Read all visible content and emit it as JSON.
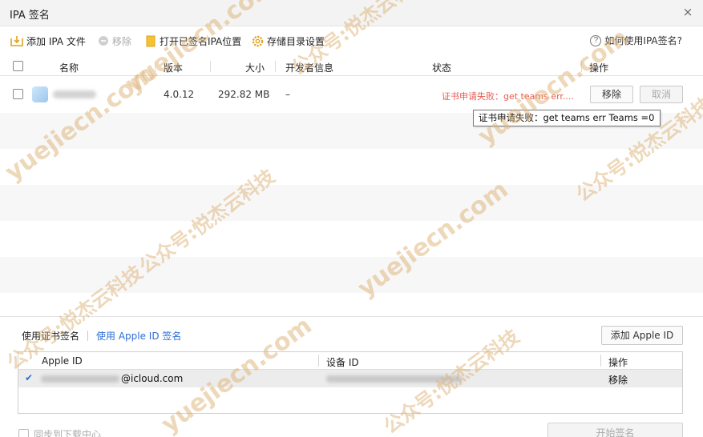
{
  "window": {
    "title": "IPA 签名",
    "close_glyph": "×"
  },
  "toolbar": {
    "add_ipa": "添加 IPA 文件",
    "remove": "移除",
    "open_signed": "打开已签名IPA位置",
    "storage_settings": "存储目录设置",
    "help": "如何使用IPA签名?",
    "help_glyph": "?"
  },
  "file_table": {
    "headers": {
      "name": "名称",
      "version": "版本",
      "size": "大小",
      "developer": "开发者信息",
      "status": "状态",
      "actions": "操作"
    },
    "rows": [
      {
        "version": "4.0.12",
        "size": "292.82 MB",
        "developer": "–",
        "status": "证书申请失败：get teams err....",
        "remove_label": "移除",
        "cancel_label": "取消"
      }
    ],
    "tooltip": "证书申请失败：get teams err Teams =0"
  },
  "sign_options": {
    "use_cert": "使用证书签名",
    "use_apple_id": "使用 Apple ID 签名",
    "add_apple_id": "添加 Apple ID"
  },
  "account_table": {
    "headers": {
      "apple_id": "Apple ID",
      "device_id": "设备 ID",
      "action": "操作"
    },
    "rows": [
      {
        "selected_mark": "✔",
        "apple_id_suffix": "@icloud.com",
        "action_label": "移除"
      }
    ]
  },
  "footer": {
    "sync_label": "同步到下载中心",
    "start_button": "开始签名"
  },
  "watermark": {
    "texts": [
      "yuejiecn.com",
      "公众号:悦杰云科技"
    ]
  },
  "colors": {
    "error": "#e85a4f",
    "link": "#2e6fd6",
    "watermark": "#deb276"
  }
}
